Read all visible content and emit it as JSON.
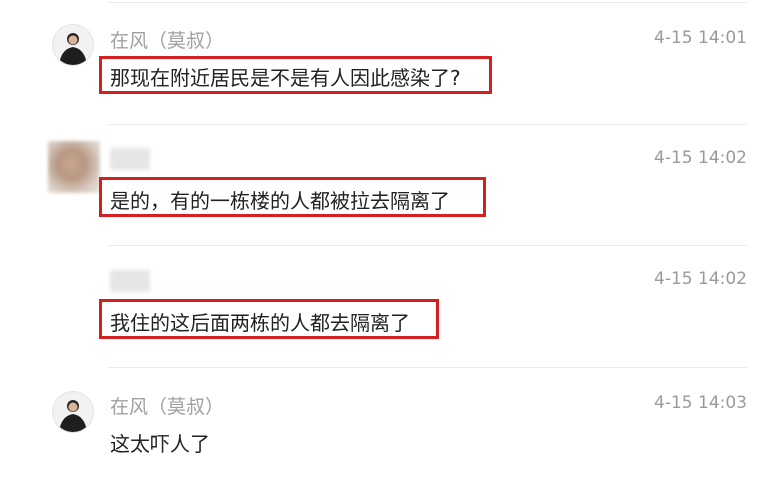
{
  "messages": [
    {
      "avatar": "person-avatar",
      "sender": "在风（莫叔）",
      "time": "4-15 14:01",
      "text": "那现在附近居民是不是有人因此感染了?",
      "highlighted": true
    },
    {
      "avatar": "blurred-avatar",
      "sender": "",
      "time": "4-15 14:02",
      "text": "是的，有的一栋楼的人都被拉去隔离了",
      "highlighted": true
    },
    {
      "avatar": "none",
      "sender": "",
      "time": "4-15 14:02",
      "text": "我住的这后面两栋的人都去隔离了",
      "highlighted": true
    },
    {
      "avatar": "person-avatar",
      "sender": "在风（莫叔）",
      "time": "4-15 14:03",
      "text": "这太吓人了",
      "highlighted": false
    }
  ],
  "colors": {
    "highlight": "#d42020",
    "name": "#a0a0a0",
    "text": "#222222",
    "divider": "#ececec"
  }
}
